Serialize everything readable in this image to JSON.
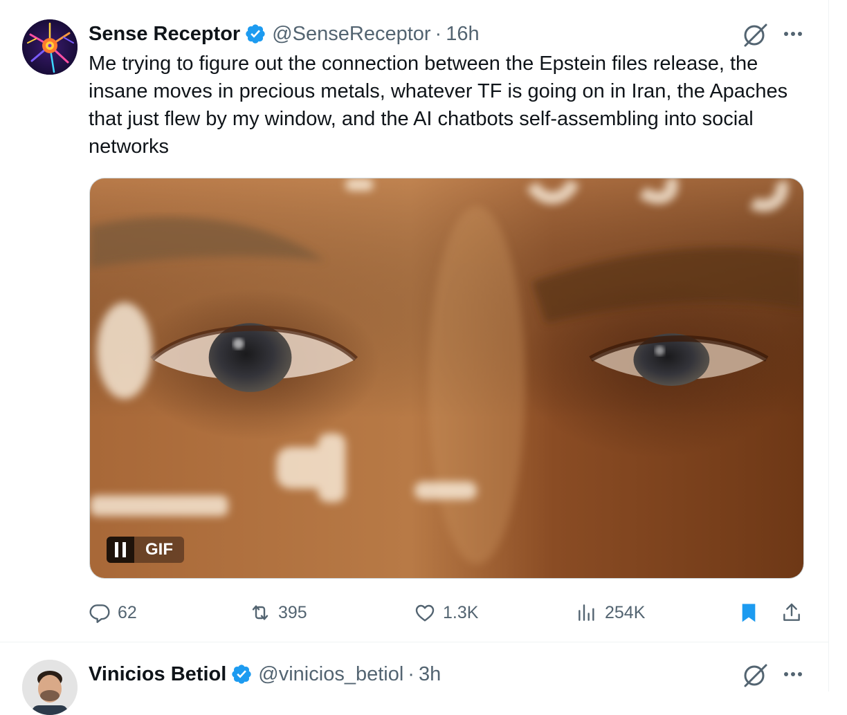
{
  "tweets": [
    {
      "author": {
        "name": "Sense Receptor",
        "handle": "@SenseReceptor",
        "time": "16h",
        "verified": true
      },
      "text": "Me trying to figure out the connection between the Epstein files release, the insane moves in precious metals, whatever TF is going on in Iran, the Apaches that just flew by my window, and the AI chatbots self-assembling into social networks",
      "media": {
        "type": "gif",
        "label": "GIF",
        "description": "Close-up of a man's eyes with floating light streaks"
      },
      "stats": {
        "replies": "62",
        "reposts": "395",
        "likes": "1.3K",
        "views": "254K",
        "bookmarked": true
      }
    },
    {
      "author": {
        "name": "Vinicios Betiol",
        "handle": "@vinicios_betiol",
        "time": "3h",
        "verified": true
      }
    }
  ],
  "colors": {
    "verified": "#1d9bf0",
    "text_secondary": "#536471",
    "bookmark_active": "#1d9bf0"
  },
  "icons": [
    "grok-icon",
    "more-icon",
    "reply-icon",
    "retweet-icon",
    "like-icon",
    "views-icon",
    "bookmark-icon",
    "share-icon",
    "pause-icon"
  ]
}
